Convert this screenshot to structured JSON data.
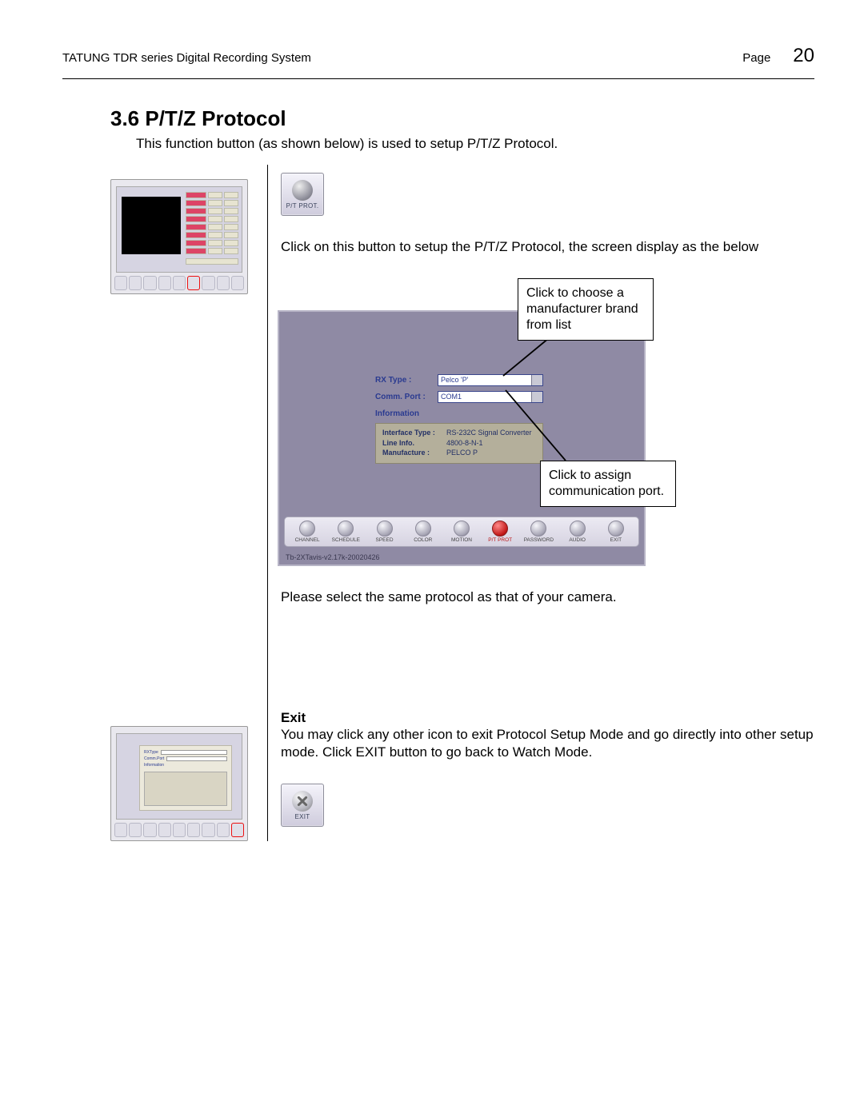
{
  "header": {
    "doc_title": "TATUNG TDR series Digital Recording System",
    "page_label": "Page",
    "page_number": "20"
  },
  "section": {
    "title": "3.6 P/T/Z Protocol",
    "intro": "This function button (as shown below) is used to setup P/T/Z Protocol."
  },
  "icon_buttons": {
    "ptprot_label": "P/T PROT.",
    "exit_label": "EXIT"
  },
  "paragraphs": {
    "click_button": "Click on this button to setup the P/T/Z Protocol, the screen display as the below",
    "same_protocol": "Please select the same protocol as that of your camera.",
    "exit_head": "Exit",
    "exit_body": "You may click any other icon to exit Protocol Setup Mode and go directly into other setup mode. Click EXIT button to go back to Watch Mode."
  },
  "callouts": {
    "choose_brand": "Click to choose a manufacturer brand from list",
    "assign_port": "Click to assign communication port."
  },
  "ptz_form": {
    "rx_type_label": "RX Type :",
    "rx_type_value": "Pelco 'P'",
    "comm_port_label": "Comm. Port :",
    "comm_port_value": "COM1",
    "info_label": "Information",
    "info": {
      "interface_k": "Interface Type :",
      "interface_v": "RS-232C Signal Converter",
      "line_k": "Line Info.",
      "line_v": "4800-8-N-1",
      "manu_k": "Manufacture :",
      "manu_v": "PELCO P"
    }
  },
  "toolbar": {
    "items": [
      {
        "name": "channel",
        "label": "CHANNEL"
      },
      {
        "name": "schedule",
        "label": "SCHEDULE"
      },
      {
        "name": "speed",
        "label": "SPEED"
      },
      {
        "name": "color",
        "label": "COLOR"
      },
      {
        "name": "motion",
        "label": "MOTION"
      },
      {
        "name": "ptprot",
        "label": "P/T PROT"
      },
      {
        "name": "password",
        "label": "PASSWORD"
      },
      {
        "name": "audio",
        "label": "AUDIO"
      },
      {
        "name": "exit",
        "label": "EXIT"
      }
    ],
    "highlight_index": 5
  },
  "status_bar": "Tb-2XTavis-v2.17k-20020426"
}
